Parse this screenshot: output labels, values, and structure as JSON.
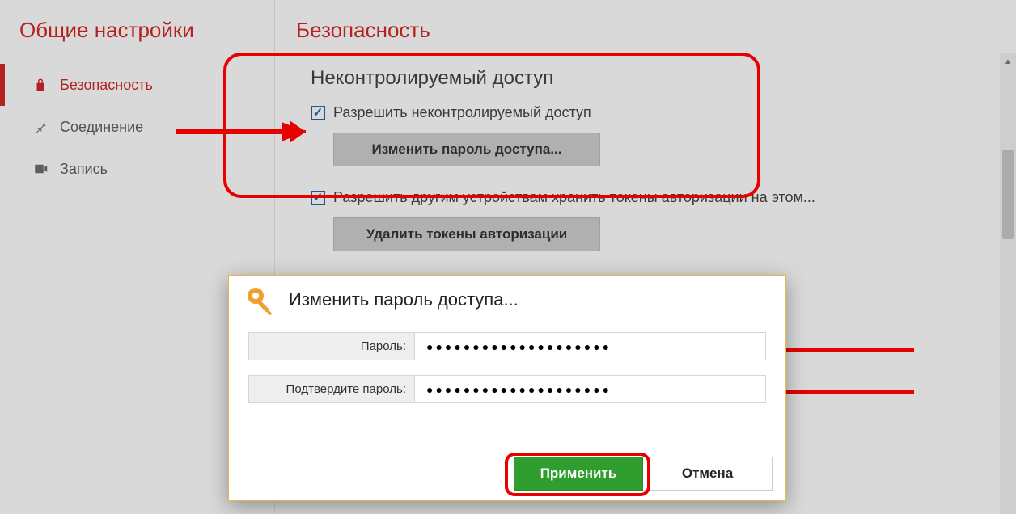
{
  "sidebar": {
    "title": "Общие настройки",
    "items": [
      {
        "label": "Безопасность",
        "icon": "lock"
      },
      {
        "label": "Соединение",
        "icon": "pin"
      },
      {
        "label": "Запись",
        "icon": "record"
      }
    ]
  },
  "main": {
    "title": "Безопасность",
    "section1": {
      "title": "Неконтролируемый доступ",
      "checkbox_label": "Разрешить неконтролируемый доступ",
      "button": "Изменить пароль доступа..."
    },
    "section2": {
      "checkbox_label": "Разрешить другим устройствам хранить токены авторизации на этом...",
      "button": "Удалить токены авторизации"
    }
  },
  "dialog": {
    "title": "Изменить пароль доступа...",
    "password_label": "Пароль:",
    "confirm_label": "Подтвердите пароль:",
    "password_value": "●●●●●●●●●●●●●●●●●●●●",
    "confirm_value": "●●●●●●●●●●●●●●●●●●●●",
    "apply": "Применить",
    "cancel": "Отмена"
  }
}
